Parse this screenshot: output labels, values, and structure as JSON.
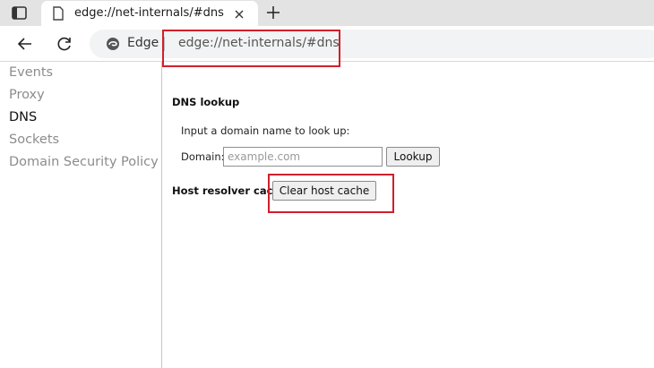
{
  "tab": {
    "title": "edge://net-internals/#dns"
  },
  "address_bar": {
    "identity_label": "Edge",
    "url": "edge://net-internals/#dns"
  },
  "sidebar": {
    "items": [
      {
        "label": "Events",
        "active": false
      },
      {
        "label": "Proxy",
        "active": false
      },
      {
        "label": "DNS",
        "active": true
      },
      {
        "label": "Sockets",
        "active": false
      },
      {
        "label": "Domain Security Policy",
        "active": false
      }
    ]
  },
  "dns_lookup": {
    "title": "DNS lookup",
    "instruction": "Input a domain name to look up:",
    "domain_label": "Domain:",
    "domain_placeholder": "example.com",
    "domain_value": "",
    "lookup_button": "Lookup"
  },
  "host_resolver": {
    "label": "Host resolver cache",
    "clear_button": "Clear host cache"
  },
  "colors": {
    "annotation": "#d21f2b",
    "tabstrip": "#e3e3e3",
    "omnibox": "#f1f3f4"
  },
  "icons": [
    "tab-actions-icon",
    "page-favicon-icon",
    "close-icon",
    "plus-icon",
    "back-arrow-icon",
    "reload-icon",
    "edge-logo-icon"
  ]
}
